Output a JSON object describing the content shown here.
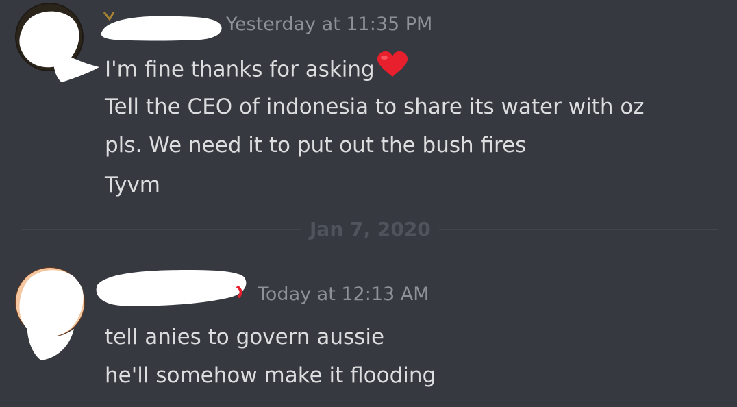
{
  "messages": [
    {
      "timestamp": "Yesterday at 11:35 PM",
      "lines": [
        "I'm fine thanks for asking",
        "Tell the CEO of indonesia to share its water with oz",
        "pls. We need it to put out the bush fires",
        "Tyvm"
      ],
      "emoji": "heart-emoji"
    },
    {
      "timestamp": "Today at 12:13 AM",
      "lines": [
        "tell anies to govern aussie",
        "he'll somehow make it flooding"
      ]
    }
  ],
  "divider": {
    "label": "Jan 7, 2020"
  },
  "colors": {
    "background": "#36393f",
    "message_text": "#dcddde",
    "timestamp": "#8e9297",
    "divider_text": "#4f545c",
    "heart": "#e8202d"
  }
}
